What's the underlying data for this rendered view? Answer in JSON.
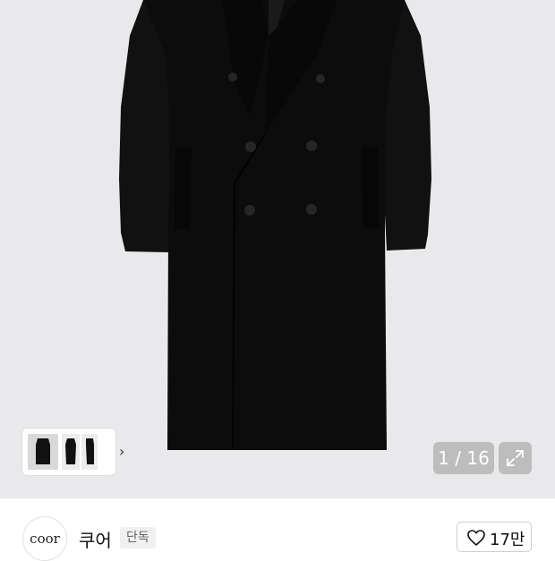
{
  "gallery": {
    "counter": "1 / 16",
    "next_icon": "chevron-right-icon",
    "expand_icon": "expand-icon"
  },
  "brand": {
    "logo_text": "coor",
    "name": "쿠어",
    "badge": "단독"
  },
  "like": {
    "icon": "heart-icon",
    "count": "17만"
  },
  "colors": {
    "background": "#e9e9eb",
    "coat": "#0c0c0c",
    "overlay": "#aaaaaa"
  }
}
